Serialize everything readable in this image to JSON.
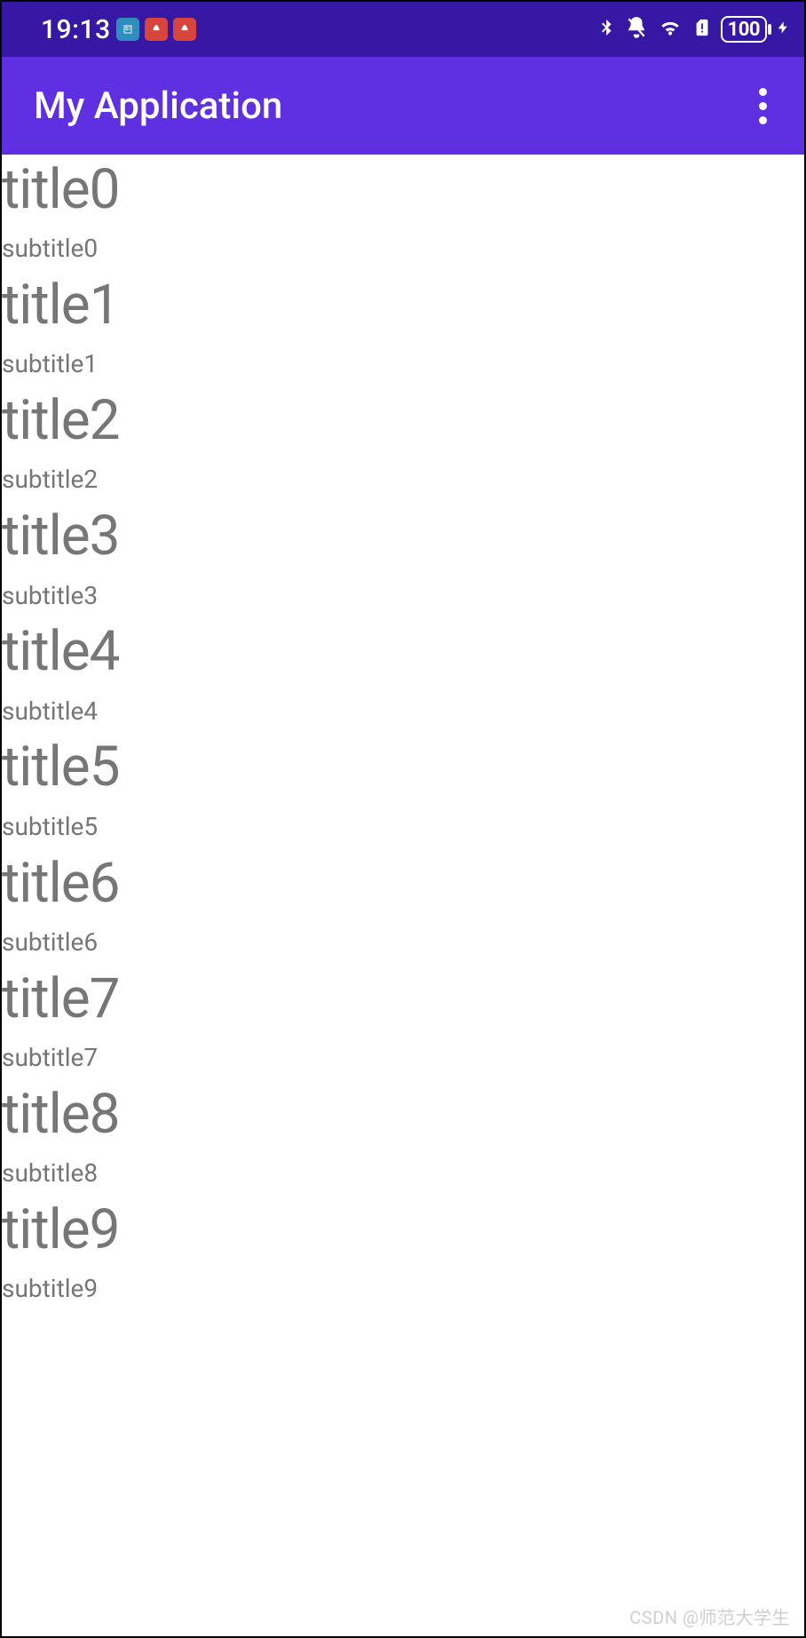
{
  "status_bar": {
    "time": "19:13",
    "battery_text": "100"
  },
  "app_bar": {
    "title": "My Application"
  },
  "list": {
    "items": [
      {
        "title": "title0",
        "subtitle": "subtitle0"
      },
      {
        "title": "title1",
        "subtitle": "subtitle1"
      },
      {
        "title": "title2",
        "subtitle": "subtitle2"
      },
      {
        "title": "title3",
        "subtitle": "subtitle3"
      },
      {
        "title": "title4",
        "subtitle": "subtitle4"
      },
      {
        "title": "title5",
        "subtitle": "subtitle5"
      },
      {
        "title": "title6",
        "subtitle": "subtitle6"
      },
      {
        "title": "title7",
        "subtitle": "subtitle7"
      },
      {
        "title": "title8",
        "subtitle": "subtitle8"
      },
      {
        "title": "title9",
        "subtitle": "subtitle9"
      }
    ]
  },
  "watermark": "CSDN @师范大学生"
}
